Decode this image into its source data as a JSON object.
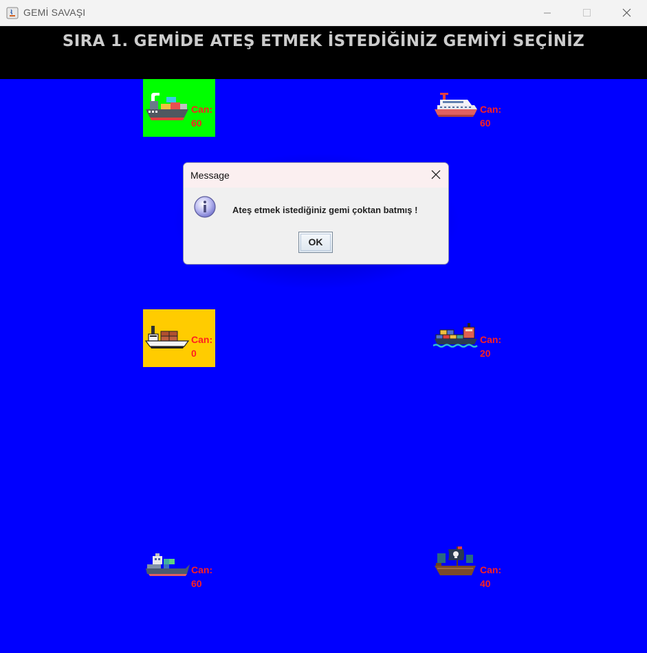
{
  "window": {
    "title": "GEMİ SAVAŞI"
  },
  "banner": {
    "text": "SIRA 1. GEMİDE ATEŞ ETMEK İSTEDİĞİNİZ GEMİYİ SEÇİNİZ"
  },
  "ships": [
    {
      "hp_label": "Can:",
      "hp_value": "60",
      "highlight": "#00ff00",
      "icon": "cargo-ship-icon"
    },
    {
      "hp_label": "Can:",
      "hp_value": "60",
      "highlight": "",
      "icon": "cruise-ship-icon"
    },
    {
      "hp_label": "Can:",
      "hp_value": "0",
      "highlight": "#ffcc00",
      "icon": "container-ship-icon"
    },
    {
      "hp_label": "Can:",
      "hp_value": "20",
      "highlight": "",
      "icon": "freighter-icon"
    },
    {
      "hp_label": "Can:",
      "hp_value": "60",
      "highlight": "",
      "icon": "patrol-ship-icon"
    },
    {
      "hp_label": "Can:",
      "hp_value": "40",
      "highlight": "",
      "icon": "pirate-ship-icon"
    }
  ],
  "dialog": {
    "title": "Message",
    "message": "Ateş etmek istediğiniz gemi çoktan batmış !",
    "ok_label": "OK"
  },
  "colors": {
    "sea": "#0000ff",
    "banner": "#000000",
    "banner_text": "#cccccc",
    "hp_text": "#ff2020"
  }
}
